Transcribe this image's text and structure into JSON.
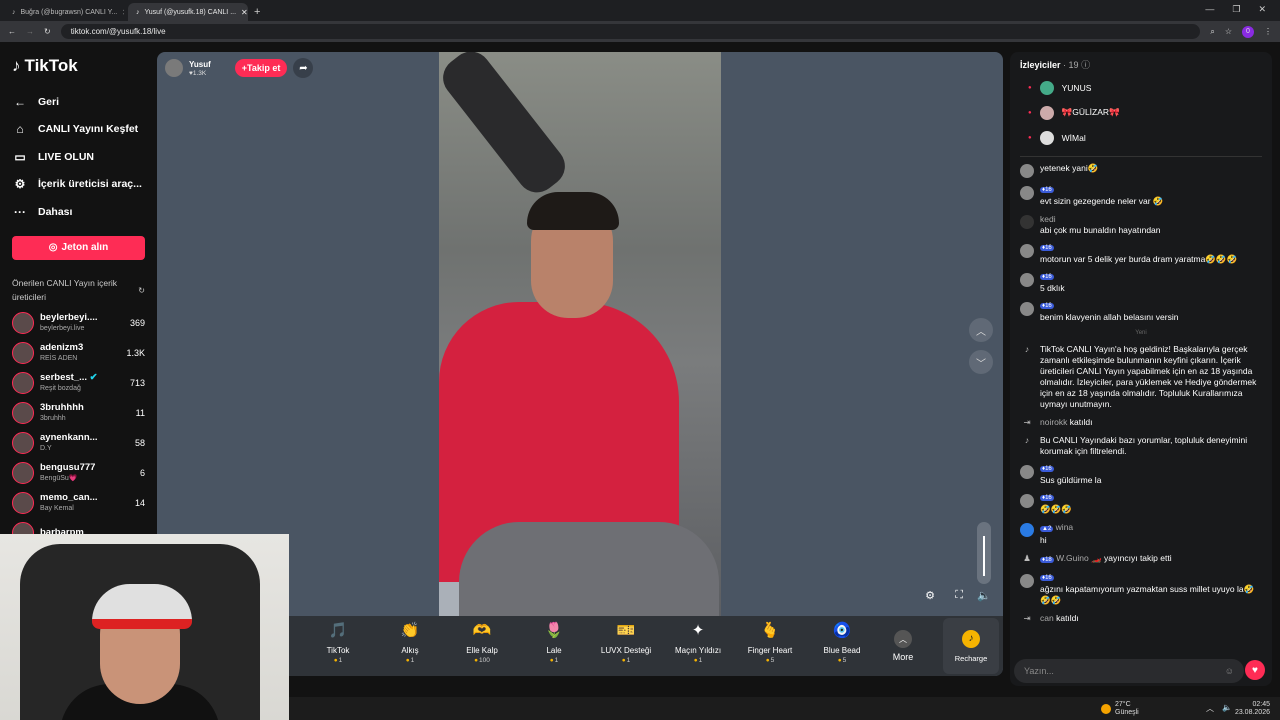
{
  "browser": {
    "tabs": [
      {
        "label": "Buğra (@bugrawsn) CANLI Y...",
        "active": false
      },
      {
        "label": "Yusuf (@yusufk.18) CANLI ...",
        "active": true
      }
    ],
    "url": "tiktok.com/@yusufk.18/live",
    "profile_initial": "0"
  },
  "sidebar": {
    "logo": "TikTok",
    "back": "Geri",
    "nav": [
      {
        "label": "CANLI Yayını Keşfet",
        "icon": "home-icon"
      },
      {
        "label": "LIVE OLUN",
        "icon": "camera-icon"
      },
      {
        "label": "İçerik üreticisi araç...",
        "icon": "tool-icon"
      },
      {
        "label": "Dahası",
        "icon": "more-icon"
      }
    ],
    "jeton_button": "Jeton alın",
    "suggested_title": "Önerilen CANLI Yayın içerik üreticileri",
    "creators": [
      {
        "name": "beylerbeyi....",
        "sub": "beylerbeyi.live",
        "count": "369"
      },
      {
        "name": "adenizm3",
        "sub": "REİS ADEN",
        "count": "1.3K"
      },
      {
        "name": "serbest_...",
        "sub": "Reşit bozdağ",
        "count": "713"
      },
      {
        "name": "3bruhhhh",
        "sub": "3bruhhh",
        "count": "11"
      },
      {
        "name": "aynenkann...",
        "sub": "D.Y",
        "count": "58"
      },
      {
        "name": "bengusu777",
        "sub": "BengüSu💗",
        "count": "6"
      },
      {
        "name": "memo_can...",
        "sub": "Bay Kemal",
        "count": "14"
      },
      {
        "name": "barbarpm",
        "sub": "",
        "count": ""
      }
    ]
  },
  "stream": {
    "host_name": "Yusuf",
    "host_likes": "1.3K",
    "follow_label": "Takip et"
  },
  "gifts": [
    {
      "name": "TikTok",
      "price": "1",
      "icon": "🎵"
    },
    {
      "name": "Alkış",
      "price": "1",
      "icon": "👏"
    },
    {
      "name": "Elle Kalp",
      "price": "100",
      "icon": "🫶"
    },
    {
      "name": "Lale",
      "price": "1",
      "icon": "🌷"
    },
    {
      "name": "LUVX Desteği",
      "price": "1",
      "icon": "🎫"
    },
    {
      "name": "Maçın Yıldızı",
      "price": "1",
      "icon": "✦"
    },
    {
      "name": "Finger Heart",
      "price": "5",
      "icon": "🫰"
    },
    {
      "name": "Blue Bead",
      "price": "5",
      "icon": "🧿"
    }
  ],
  "gift_more": "More",
  "recharge": "Recharge",
  "chat": {
    "viewers_title": "İzleyiciler",
    "viewers_count": "· 19",
    "viewers": [
      "YUNUS",
      "🎀GÜLİZAR🎀",
      "WİMal"
    ],
    "messages": [
      {
        "user": "",
        "level": "16",
        "text": "yetenek yani🤣"
      },
      {
        "user": "",
        "level": "16",
        "text": "evt sizin gezegende neler var 🤣"
      },
      {
        "user": "kedi",
        "level": "",
        "text": "abi çok mu bunaldın hayatından"
      },
      {
        "user": "",
        "level": "16",
        "text": "motorun var 5 delik yer burda dram yaratma🤣🤣🤣"
      },
      {
        "user": "",
        "level": "16",
        "text": "5 dklık"
      },
      {
        "user": "",
        "level": "16",
        "text": "benim klavyenin allah belasını versin"
      }
    ],
    "new_divider": "Yeni",
    "welcome": "TikTok CANLI Yayın'a hoş geldiniz! Başkalarıyla gerçek zamanlı etkileşimde bulunmanın keyfini çıkarın. İçerik üreticileri CANLI Yayın yapabilmek için en az 18 yaşında olmalıdır. İzleyiciler, para yüklemek ve Hediye göndermek için en az 18 yaşında olmalıdır. Topluluk Kurallarımıza uymayı unutmayın.",
    "join1_user": "noirokk",
    "join_text": "katıldı",
    "filter_notice": "Bu CANLI Yayındaki bazı yorumlar, topluluk deneyimini korumak için filtrelendi.",
    "messages2": [
      {
        "user": "",
        "level": "16",
        "text": "Sus güldürme la"
      },
      {
        "user": "",
        "level": "16",
        "text": "🤣🤣🤣"
      },
      {
        "user": "wina",
        "level": "2",
        "text": "hi"
      }
    ],
    "follow_event_user": "W.Guino 🏎️",
    "follow_event_level": "18",
    "follow_event_text": "yayıncıyı takip etti",
    "messages3": [
      {
        "user": "",
        "level": "16",
        "text": "ağzını kapatamıyorum yazmaktan suss millet uyuyo la🤣🤣🤣"
      }
    ],
    "join2_user": "can",
    "input_placeholder": "Yazın..."
  },
  "taskbar": {
    "temp": "27°C",
    "weather": "Güneşli",
    "time": "02:45",
    "date": "23.08.2026"
  }
}
